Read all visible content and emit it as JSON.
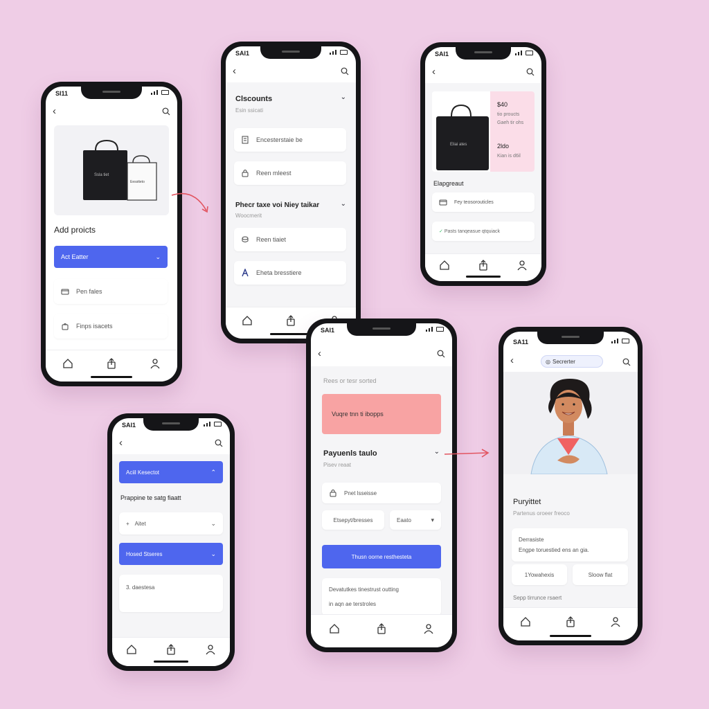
{
  "colors": {
    "background": "#efcde6",
    "accent_blue": "#4e66ee",
    "accent_pink": "#f8a3a3",
    "arrow_red": "#e25561"
  },
  "phone1": {
    "status_time": "SI11",
    "title": "Add proicts",
    "blue_label": "Act Eatter",
    "items": [
      "Pen fales",
      "Finps isacets"
    ]
  },
  "phone2": {
    "status_time": "SAI1",
    "section1_title": "Clscounts",
    "section1_sub": "Esin ssicati",
    "items1": [
      "Encesterstaie be",
      "Reen mleest"
    ],
    "section2_title": "Phecr taxe voi Niey taikar",
    "section2_sub": "Woocmerit",
    "items2": [
      "Reen tiaiet",
      "Eheta bresstiere"
    ]
  },
  "phone3": {
    "status_time": "SAI1",
    "bag_label": "Eliai ates",
    "price1": "$40",
    "line1": "tio proucts",
    "line2": "Gaeh tir ohs",
    "price2": "2ldo",
    "line3": "Kian is d6il",
    "section_title": "Elapgreaut",
    "items": [
      "Fey teosorouticles"
    ],
    "green_item": "Pasts tanqeasue qtquiack"
  },
  "phone4": {
    "status_time": "SAI1",
    "blue1": "Aciil Kesectot",
    "title": "Prappine te satg fiaatt",
    "item1": "Aitet",
    "blue2": "Hosed Stseres",
    "note": "3. daestesa"
  },
  "phone5": {
    "status_time": "SAI1",
    "header_text": "Rees or tesr sorted",
    "pink_label": "Vuqre tnn ti ibopps",
    "section_title": "Payuenls taulo",
    "section_sub": "Pisev reaat",
    "item1": "Pnet lsseisse",
    "field1": "Etsepyt/bresses",
    "field2": "Eaato",
    "blue_label": "Thusn oorne resthesteta",
    "note1": "Devatutkes tinestrust outting",
    "note2": "in aqn ae terstroles"
  },
  "phone6": {
    "status_time": "SA11",
    "pill_label": "Secrerter",
    "title": "Puryittet",
    "sub": "Partenus oroeer freoco",
    "box1": "Derrasiste",
    "box2": "Engpe toruestied ens an gia.",
    "btn1": "1Yowahexis",
    "btn2": "Sloow flat",
    "footer": "Sepp tirrunce rsaert"
  }
}
